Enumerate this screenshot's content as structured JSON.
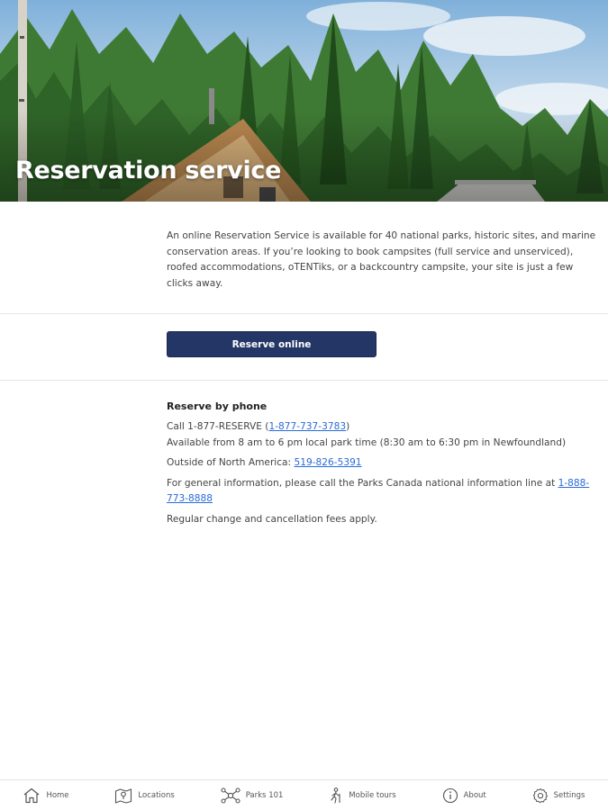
{
  "hero": {
    "title": "Reservation service"
  },
  "intro": {
    "text": "An online Reservation Service is available for 40 national parks, historic sites, and marine conservation areas. If you’re looking to book campsites (full service and unserviced), roofed accommodations, oTENTiks, or a backcountry campsite, your site is just a few clicks away."
  },
  "reserve": {
    "button_label": "Reserve online"
  },
  "phone": {
    "heading": "Reserve by phone",
    "call_prefix": "Call 1-877-RESERVE (",
    "call_number": "1-877-737-3783",
    "call_suffix": ")",
    "hours": "Available from 8 am to 6 pm local park time (8:30 am to 6:30 pm in Newfoundland)",
    "outside_prefix": "Outside of North America: ",
    "outside_number": "519-826-5391",
    "info_prefix": "For general information, please call the Parks Canada national information line at ",
    "info_number": "1-888-773-8888",
    "fees": "Regular change and cancellation fees apply."
  },
  "nav": {
    "items": [
      {
        "label": "Home",
        "icon": "home-icon"
      },
      {
        "label": "Locations",
        "icon": "locations-icon"
      },
      {
        "label": "Parks 101",
        "icon": "parks-101-icon"
      },
      {
        "label": "Mobile tours",
        "icon": "mobile-tours-icon"
      },
      {
        "label": "About",
        "icon": "about-icon"
      },
      {
        "label": "Settings",
        "icon": "settings-icon"
      }
    ]
  },
  "colors": {
    "button": "#243666",
    "link": "#2a6ad9",
    "sky": "#8cb8dd",
    "forest": "#2e6b2c"
  }
}
